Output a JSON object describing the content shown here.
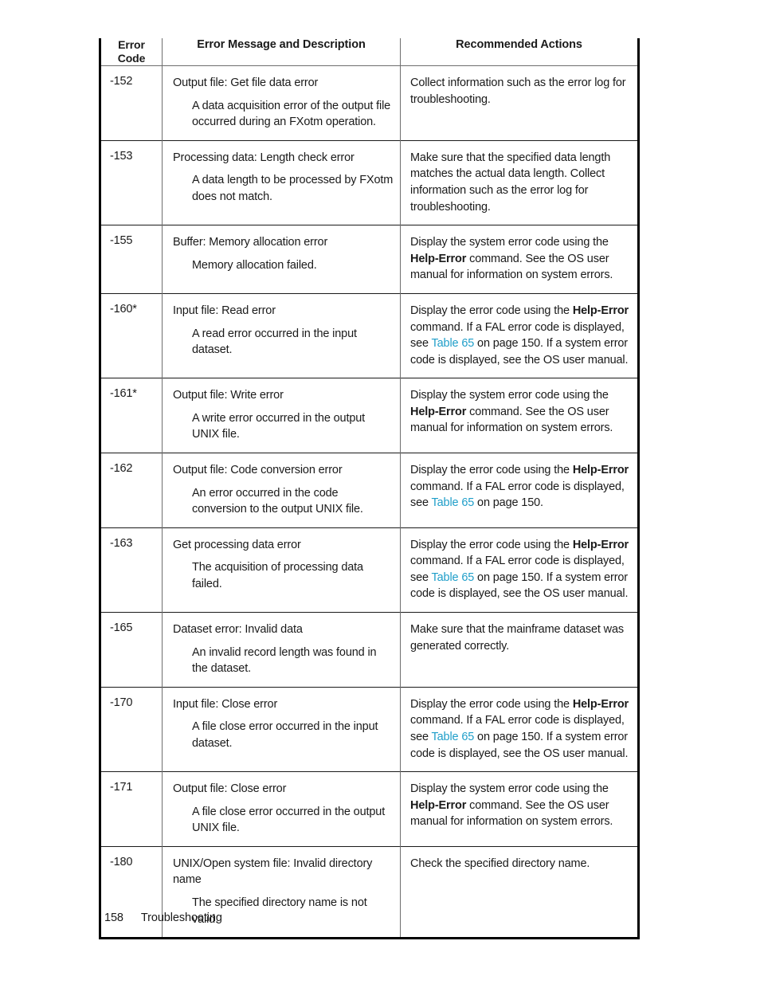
{
  "page": {
    "footer_page_number": "158",
    "footer_chapter": "Troubleshooting"
  },
  "link_color": "#1f9ec9",
  "table": {
    "headers": {
      "code": "Error\nCode",
      "code_line1": "Error",
      "code_line2": "Code",
      "message": "Error Message and Description",
      "actions": "Recommended Actions"
    },
    "rows": [
      {
        "code": "-152",
        "msg_title": "Output file: Get file data error",
        "msg_desc": "A data acquisition error of the output file occurred during an FXotm operation.",
        "action_parts": [
          {
            "type": "text",
            "text": "Collect information such as the error log for troubleshooting."
          }
        ]
      },
      {
        "code": "-153",
        "msg_title": "Processing data: Length check error",
        "msg_desc": "A data length to be processed by FXotm does not match.",
        "action_parts": [
          {
            "type": "text",
            "text": "Make sure that the specified data length matches the actual data length. Collect information such as the error log for troubleshooting."
          }
        ]
      },
      {
        "code": "-155",
        "msg_title": "Buffer: Memory allocation error",
        "msg_desc": "Memory allocation failed.",
        "action_parts": [
          {
            "type": "text",
            "text": "Display the system error code using the "
          },
          {
            "type": "bold",
            "text": "Help-Error"
          },
          {
            "type": "text",
            "text": " command. See the OS user manual for information on system errors."
          }
        ]
      },
      {
        "code": "-160*",
        "msg_title": "Input file: Read error",
        "msg_desc": "A read error occurred in the input dataset.",
        "action_parts": [
          {
            "type": "text",
            "text": "Display the error code using the "
          },
          {
            "type": "bold",
            "text": "Help-Error"
          },
          {
            "type": "text",
            "text": " command. If a FAL error code is displayed, see "
          },
          {
            "type": "link",
            "text": "Table 65"
          },
          {
            "type": "text",
            "text": " on page 150. If a system error code is displayed, see the OS user manual."
          }
        ]
      },
      {
        "code": "-161*",
        "msg_title": "Output file: Write error",
        "msg_desc": "A write error occurred in the output UNIX file.",
        "action_parts": [
          {
            "type": "text",
            "text": "Display the system error code using the "
          },
          {
            "type": "bold",
            "text": "Help-Error"
          },
          {
            "type": "text",
            "text": " command. See the OS user manual for information on system errors."
          }
        ]
      },
      {
        "code": "-162",
        "msg_title": "Output file: Code conversion error",
        "msg_desc": "An error occurred in the code conversion to the output UNIX file.",
        "action_parts": [
          {
            "type": "text",
            "text": "Display the error code using the "
          },
          {
            "type": "bold",
            "text": "Help-Error"
          },
          {
            "type": "text",
            "text": " command. If a FAL error code is displayed, see "
          },
          {
            "type": "link",
            "text": "Table 65"
          },
          {
            "type": "text",
            "text": " on page 150."
          }
        ]
      },
      {
        "code": "-163",
        "msg_title": "Get processing data error",
        "msg_desc": "The acquisition of processing data failed.",
        "action_parts": [
          {
            "type": "text",
            "text": "Display the error code using the "
          },
          {
            "type": "bold",
            "text": "Help-Error"
          },
          {
            "type": "text",
            "text": " command. If a FAL error code is displayed, see "
          },
          {
            "type": "link",
            "text": "Table 65"
          },
          {
            "type": "text",
            "text": " on page 150. If a system error code is displayed, see the OS user manual."
          }
        ]
      },
      {
        "code": "-165",
        "msg_title": "Dataset error: Invalid data",
        "msg_desc": "An invalid record length was found in the dataset.",
        "action_parts": [
          {
            "type": "text",
            "text": "Make sure that the mainframe dataset was generated correctly."
          }
        ]
      },
      {
        "code": "-170",
        "msg_title": "Input file: Close error",
        "msg_desc": "A file close error occurred in the input dataset.",
        "action_parts": [
          {
            "type": "text",
            "text": "Display the error code using the "
          },
          {
            "type": "bold",
            "text": "Help-Error"
          },
          {
            "type": "text",
            "text": " command. If a FAL error code is displayed, see "
          },
          {
            "type": "link",
            "text": "Table 65"
          },
          {
            "type": "text",
            "text": " on page 150. If a system error code is displayed, see the OS user manual."
          }
        ]
      },
      {
        "code": "-171",
        "msg_title": "Output file: Close error",
        "msg_desc": "A file close error occurred in the output UNIX file.",
        "action_parts": [
          {
            "type": "text",
            "text": "Display the system error code using the "
          },
          {
            "type": "bold",
            "text": "Help-Error"
          },
          {
            "type": "text",
            "text": " command. See the OS user manual for information on system errors."
          }
        ]
      },
      {
        "code": "-180",
        "msg_title": "UNIX/Open system file: Invalid directory name",
        "msg_desc": "The specified directory name is not valid.",
        "action_parts": [
          {
            "type": "text",
            "text": "Check the specified directory name."
          }
        ]
      }
    ]
  }
}
